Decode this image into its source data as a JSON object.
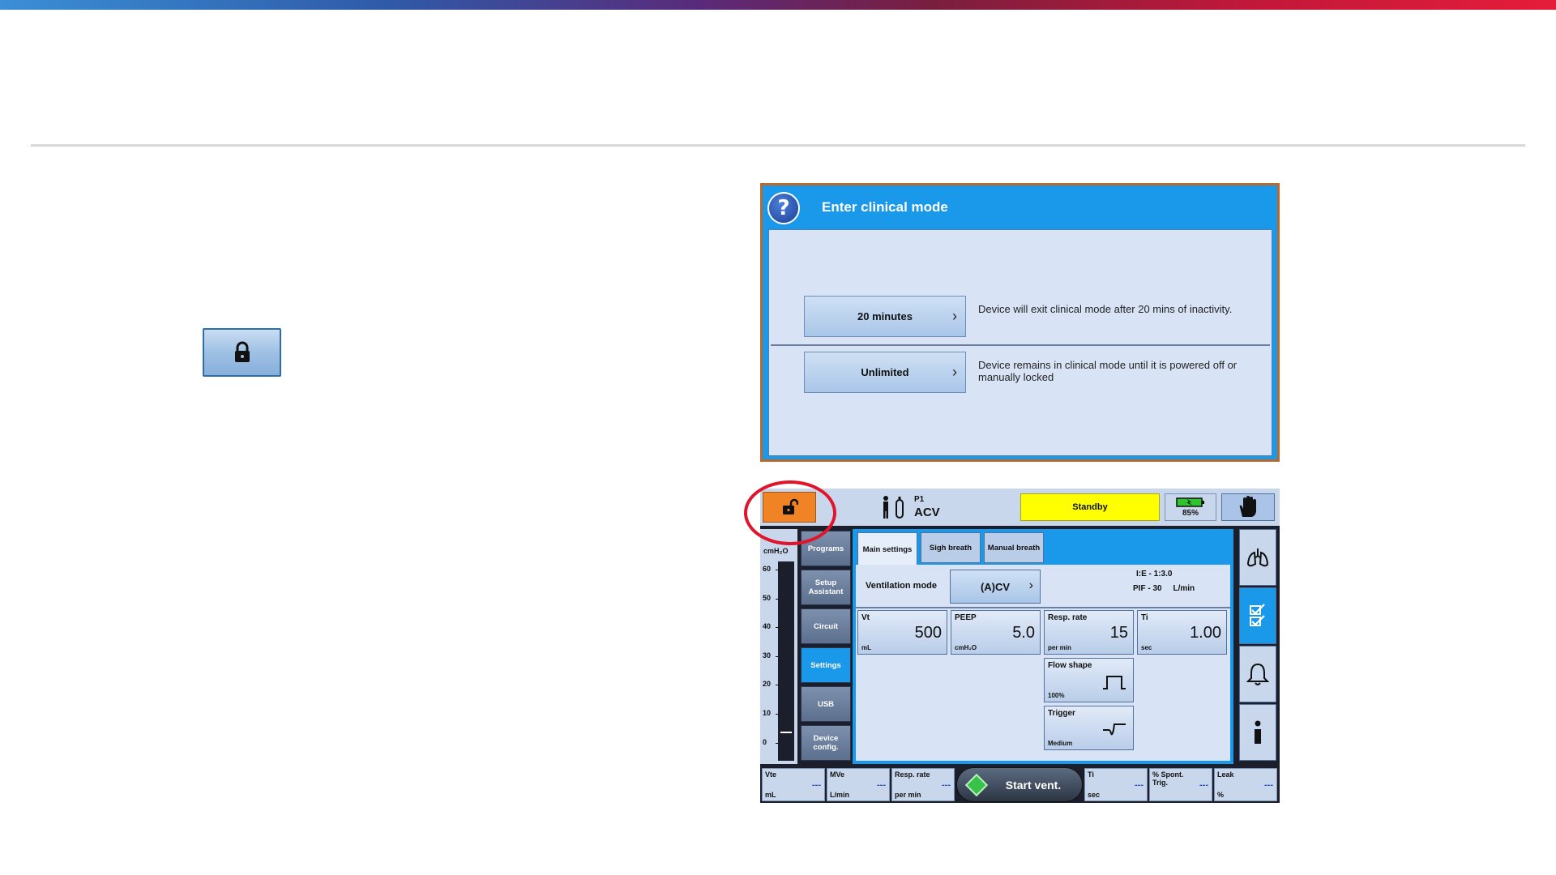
{
  "dialog": {
    "title": "Enter clinical mode",
    "options": [
      {
        "label": "20 minutes",
        "description": "Device will exit clinical mode after 20 mins of inactivity."
      },
      {
        "label": "Unlimited",
        "description": "Device remains in clinical mode until it is powered off or manually locked"
      }
    ]
  },
  "ventilator": {
    "patient": {
      "label": "P1",
      "mode": "ACV"
    },
    "status": "Standby",
    "battery": "85%",
    "gauge": {
      "unit": "cmH₂O",
      "ticks": [
        "60",
        "50",
        "40",
        "30",
        "20",
        "10",
        "0"
      ]
    },
    "nav": [
      "Programs",
      "Setup Assistant",
      "Circuit",
      "Settings",
      "USB",
      "Device config."
    ],
    "nav_active": "Settings",
    "tabs": [
      "Main settings",
      "Sigh breath",
      "Manual breath"
    ],
    "ventilation_mode_label": "Ventilation mode",
    "ventilation_mode_value": "(A)CV",
    "ie_ratio": "I:E - 1:3.0",
    "pif": "PIF - 30     L/min",
    "params": [
      {
        "name": "Vt",
        "value": "500",
        "unit": "mL"
      },
      {
        "name": "PEEP",
        "value": "5.0",
        "unit": "cmH₂O"
      },
      {
        "name": "Resp. rate",
        "value": "15",
        "unit": "per min"
      },
      {
        "name": "Ti",
        "value": "1.00",
        "unit": "sec"
      },
      {
        "name": "Flow shape",
        "value": "",
        "unit": "100%"
      },
      {
        "name": "Trigger",
        "value": "",
        "unit": "Medium"
      }
    ],
    "bottom": [
      {
        "name": "Vte",
        "unit": "mL",
        "value": "---"
      },
      {
        "name": "MVe",
        "unit": "L/min",
        "value": "---"
      },
      {
        "name": "Resp. rate",
        "unit": "per min",
        "value": "---"
      },
      {
        "name": "Ti",
        "unit": "sec",
        "value": "---"
      },
      {
        "name": "% Spont. Trig.",
        "unit": "",
        "value": "---"
      },
      {
        "name": "Leak",
        "unit": "%",
        "value": "---"
      }
    ],
    "start_label": "Start vent."
  },
  "colors": {
    "accent": "#1a98ea",
    "unlock": "#f08324",
    "standby": "#ffff00",
    "highlight": "#e0142a"
  }
}
